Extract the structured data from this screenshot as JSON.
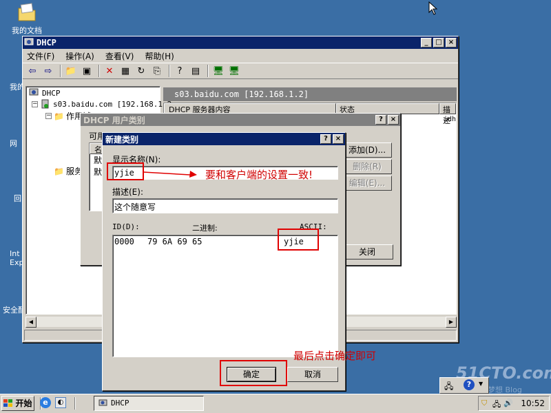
{
  "desktop": {
    "icons": [
      {
        "label": "我的文档"
      },
      {
        "label": "我的"
      },
      {
        "label": "网"
      },
      {
        "label": "回"
      },
      {
        "label": "Int"
      },
      {
        "label": "Exp"
      },
      {
        "label": "安全配"
      }
    ]
  },
  "dhcp_window": {
    "title": "DHCP",
    "menu": [
      "文件(F)",
      "操作(A)",
      "查看(V)",
      "帮助(H)"
    ],
    "tree": {
      "root": "DHCP",
      "server": "s03.baidu.com [192.168.1.2",
      "scope": "作用域",
      "options": "服务"
    },
    "right_header": "s03.baidu.com [192.168.1.2]",
    "columns": [
      "DHCP 服务器内容",
      "状态",
      "描述"
    ],
    "col_desc_cell": "idh"
  },
  "user_class_dialog": {
    "title": "DHCP 用户类别",
    "available_label": "可用",
    "list_header": "名",
    "list_items": [
      "默",
      "默"
    ],
    "add_button": "添加(D)...",
    "delete_button": "删除(R)",
    "edit_button": "编辑(E)...",
    "close_button": "关闭"
  },
  "new_class_dialog": {
    "title": "新建类别",
    "display_name_label": "显示名称(N):",
    "display_name_value": "yjie",
    "description_label": "描述(E):",
    "description_value": "这个随意写",
    "id_label": "ID(D):",
    "binary_label": "二进制:",
    "ascii_label": "ASCII:",
    "hex_offset": "0000",
    "hex_bytes": "79 6A 69 65",
    "ascii_value": "yjie",
    "ok_button": "确定",
    "cancel_button": "取消"
  },
  "annotations": {
    "match_client": "要和客户端的设置一致!",
    "click_ok": "最后点击确定即可"
  },
  "watermark": {
    "brand": "51CTO.com",
    "sub": "技术成就梦想 Blog"
  },
  "taskbar": {
    "start_label": "开始",
    "task_label": "DHCP",
    "clock": "10:52"
  },
  "colors": {
    "desktop": "#3a6ea5",
    "title_active": "#0a246a",
    "annotation_red": "#e00000"
  }
}
